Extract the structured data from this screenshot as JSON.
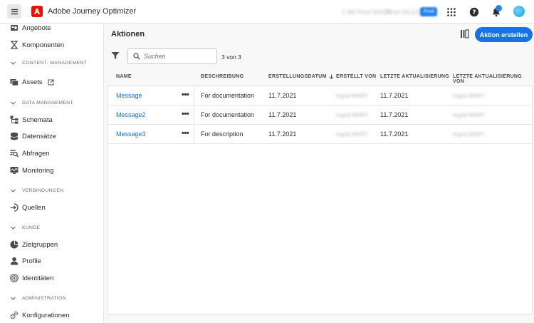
{
  "topbar": {
    "app_title": "Adobe Journey Optimizer",
    "org_name": "CJM Prod NA/DX",
    "sandbox_name": "Prod (NLD2)",
    "sandbox_badge": "Prod",
    "brand_color": "#eb1000"
  },
  "sidebar": {
    "items": [
      {
        "label": "Angebote",
        "icon": "offers-icon"
      },
      {
        "label": "Komponenten",
        "icon": "components-icon"
      }
    ],
    "sections": [
      {
        "label": "CONTENT- MANAGEMENT",
        "items": [
          {
            "label": "Assets",
            "icon": "assets-icon",
            "external": true
          }
        ]
      },
      {
        "label": "DATA MANAGEMENT",
        "items": [
          {
            "label": "Schemata",
            "icon": "schema-icon"
          },
          {
            "label": "Datensätze",
            "icon": "datasets-icon"
          },
          {
            "label": "Abfragen",
            "icon": "queries-icon"
          },
          {
            "label": "Monitoring",
            "icon": "monitoring-icon"
          }
        ]
      },
      {
        "label": "VERBINDUNGEN",
        "items": [
          {
            "label": "Quellen",
            "icon": "sources-icon"
          }
        ]
      },
      {
        "label": "KUNDE",
        "items": [
          {
            "label": "Zielgruppen",
            "icon": "segments-icon"
          },
          {
            "label": "Profile",
            "icon": "profile-icon"
          },
          {
            "label": "Identitäten",
            "icon": "identities-icon"
          }
        ]
      },
      {
        "label": "ADMINISTRATION",
        "items": [
          {
            "label": "Konfigurationen",
            "icon": "configurations-icon"
          }
        ]
      }
    ]
  },
  "main": {
    "title": "Aktionen",
    "create_button": "Aktion erstellen",
    "search_placeholder": "Suchen",
    "count": "3 von 3",
    "columns": [
      "NAME",
      "BESCHREIBUNG",
      "ERSTELLUNGSDATUM",
      "ERSTELLT VON",
      "LETZTE AKTUALISIERUNG",
      "LETZTE AKTUALISIERUNG VON"
    ],
    "rows": [
      {
        "name": "Message",
        "description": "For documentation",
        "created": "11.7.2021",
        "created_by": "Ingrid MARY",
        "updated": "11.7.2021",
        "updated_by": "Ingrid MARY"
      },
      {
        "name": "Message2",
        "description": "For documentation",
        "created": "11.7.2021",
        "created_by": "Ingrid MARY",
        "updated": "11.7.2021",
        "updated_by": "Ingrid MARY"
      },
      {
        "name": "Message3",
        "description": "For description",
        "created": "11.7.2021",
        "created_by": "Ingrid MARY",
        "updated": "11.7.2021",
        "updated_by": "Ingrid MARY"
      }
    ],
    "more_label": "•••",
    "accent_color": "#1473e6"
  }
}
